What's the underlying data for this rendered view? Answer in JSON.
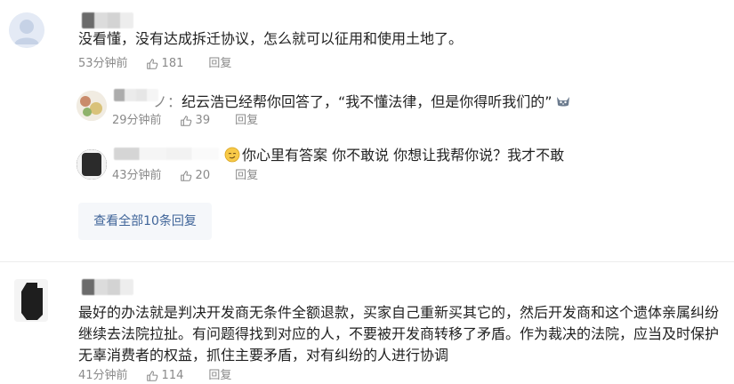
{
  "comments": [
    {
      "text": "没看懂，没有达成拆迁协议，怎么就可以征用和使用土地了。",
      "time": "53分钟前",
      "likes": "181",
      "reply_label": "回复",
      "replies": [
        {
          "text_prefix": "ノ：",
          "text": "纪云浩已经帮你回答了，“我不懂法律，但是你得听我们的”",
          "emoji": "cat-face-emoji",
          "time": "29分钟前",
          "likes": "39",
          "reply_label": "回复"
        },
        {
          "emoji": "smirk-face-emoji",
          "text": "你心里有答案 你不敢说  你想让我帮你说？我才不敢",
          "time": "43分钟前",
          "likes": "20",
          "reply_label": "回复"
        }
      ],
      "more_replies_label": "查看全部10条回复"
    },
    {
      "text_lines": [
        "最好的办法就是判决开发商无条件全额退款，买家自己重新买其它的，然后开发商和这个遗体亲属纠纷",
        "继续去法院拉扯。有问题得找到对应的人，不要被开发商转移了矛盾。作为裁决的法院，应当及时保护",
        "无辜消费者的权益，抓住主要矛盾，对有纠纷的人进行协调"
      ],
      "time": "41分钟前",
      "likes": "114",
      "reply_label": "回复"
    }
  ],
  "colors": {
    "meta_gray": "#8a8a8a",
    "link_blue": "#406599",
    "button_bg": "#f5f7fa",
    "divider": "#ececec"
  }
}
